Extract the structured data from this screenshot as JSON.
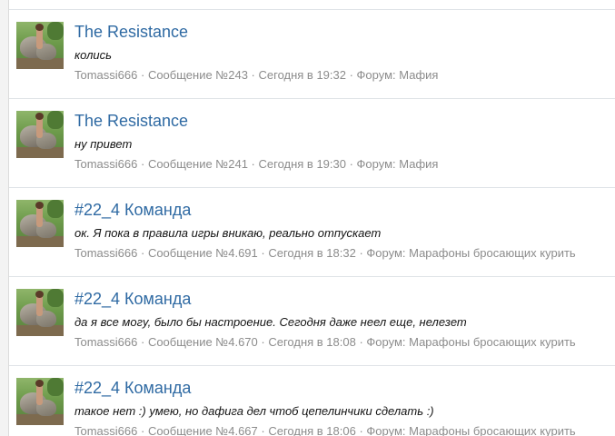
{
  "separator": " · ",
  "results": [
    {
      "title": "The Resistance",
      "snippet": "колись",
      "author": "Tomassi666",
      "message": "Сообщение №243",
      "time": "Сегодня в 19:32",
      "forum": "Форум: Мафия"
    },
    {
      "title": "The Resistance",
      "snippet": "ну привет",
      "author": "Tomassi666",
      "message": "Сообщение №241",
      "time": "Сегодня в 19:30",
      "forum": "Форум: Мафия"
    },
    {
      "title": "#22_4 Команда",
      "snippet": "ок. Я пока в правила игры вникаю, реально отпускает",
      "author": "Tomassi666",
      "message": "Сообщение №4.691",
      "time": "Сегодня в 18:32",
      "forum": "Форум: Марафоны бросающих курить"
    },
    {
      "title": "#22_4 Команда",
      "snippet": "да я все могу, было бы настроение. Сегодня даже неел еще, нелезет",
      "author": "Tomassi666",
      "message": "Сообщение №4.670",
      "time": "Сегодня в 18:08",
      "forum": "Форум: Марафоны бросающих курить"
    },
    {
      "title": "#22_4 Команда",
      "snippet": "такое нет :) умею, но дафига дел чтоб цепелинчики сделать :)",
      "author": "Tomassi666",
      "message": "Сообщение №4.667",
      "time": "Сегодня в 18:06",
      "forum": "Форум: Марафоны бросающих курить"
    }
  ]
}
